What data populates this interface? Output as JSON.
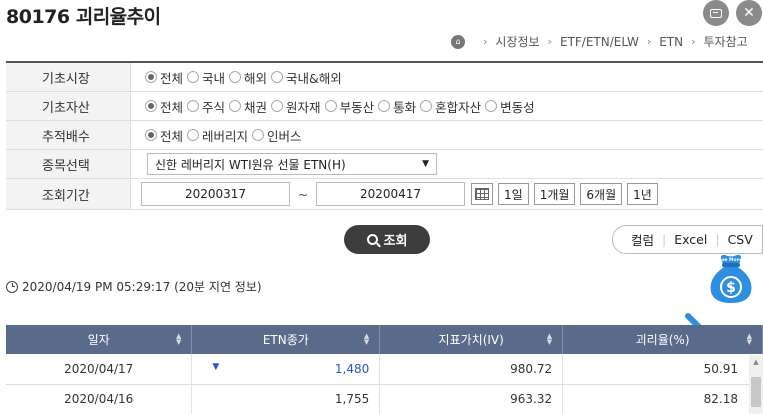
{
  "page": {
    "title": "80176 괴리율추이"
  },
  "window": {
    "expand_icon": "expand-icon",
    "close_icon": "close-icon",
    "close_glyph": "✕"
  },
  "breadcrumb": {
    "home_icon": "home-icon",
    "items": [
      "시장정보",
      "ETF/ETN/ELW",
      "ETN",
      "투자참고"
    ],
    "separator": "›"
  },
  "filters": {
    "market": {
      "label": "기초시장",
      "options": [
        "전체",
        "국내",
        "해외",
        "국내&해외"
      ],
      "selected": 0
    },
    "asset": {
      "label": "기초자산",
      "options": [
        "전체",
        "주식",
        "채권",
        "원자재",
        "부동산",
        "통화",
        "혼합자산",
        "변동성"
      ],
      "selected": 0
    },
    "multiple": {
      "label": "추적배수",
      "options": [
        "전체",
        "레버리지",
        "인버스"
      ],
      "selected": 0
    },
    "product": {
      "label": "종목선택",
      "value": "신한 레버리지 WTI원유 선물 ETN(H)"
    },
    "period": {
      "label": "조회기간",
      "start": "20200317",
      "tilde": "~",
      "end": "20200417",
      "buttons": [
        "1일",
        "1개월",
        "6개월",
        "1년"
      ]
    }
  },
  "actions": {
    "search_label": "조회",
    "export": [
      "컬럼",
      "Excel",
      "CSV"
    ],
    "export_divider": "|"
  },
  "timestamp": "2020/04/19 PM 05:29:17 (20분 지연 정보)",
  "decor": {
    "bag_top": "Blue Money",
    "bag_symbol": "$"
  },
  "table": {
    "columns": [
      "일자",
      "ETN종가",
      "지표가치(IV)",
      "괴리율(%)"
    ],
    "rows": [
      {
        "date": "2020/04/17",
        "close": "1,480",
        "close_dir": "down",
        "iv": "980.72",
        "gap": "50.91"
      },
      {
        "date": "2020/04/16",
        "close": "1,755",
        "close_dir": "",
        "iv": "963.32",
        "gap": "82.18"
      }
    ]
  },
  "colors": {
    "header_bg": "#5a6a8a",
    "accent_blue": "#2a56c6",
    "search_btn": "#3d3d3d",
    "moneybag": "#2e8fe0"
  }
}
